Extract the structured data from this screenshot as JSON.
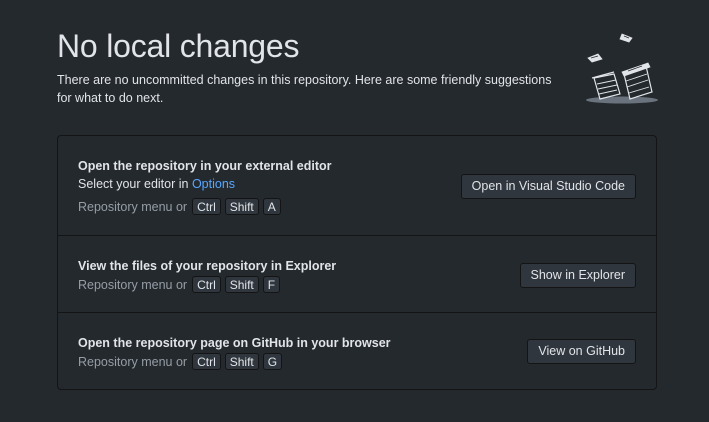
{
  "header": {
    "title": "No local changes",
    "subtitle": "There are no uncommitted changes in this repository. Here are some friendly suggestions for what to do next."
  },
  "illustration": {
    "icon": "paper-stacks-icon"
  },
  "suggestions": [
    {
      "title": "Open the repository in your external editor",
      "desc_prefix": "Select your editor in ",
      "desc_link": "Options",
      "shortcut_prefix": "Repository menu or",
      "keys": [
        "Ctrl",
        "Shift",
        "A"
      ],
      "button": "Open in Visual Studio Code"
    },
    {
      "title": "View the files of your repository in Explorer",
      "shortcut_prefix": "Repository menu or",
      "keys": [
        "Ctrl",
        "Shift",
        "F"
      ],
      "button": "Show in Explorer"
    },
    {
      "title": "Open the repository page on GitHub in your browser",
      "shortcut_prefix": "Repository menu or",
      "keys": [
        "Ctrl",
        "Shift",
        "G"
      ],
      "button": "View on GitHub"
    }
  ],
  "colors": {
    "background": "#24292e",
    "link": "#58a6ff",
    "button": "#2f363d"
  }
}
